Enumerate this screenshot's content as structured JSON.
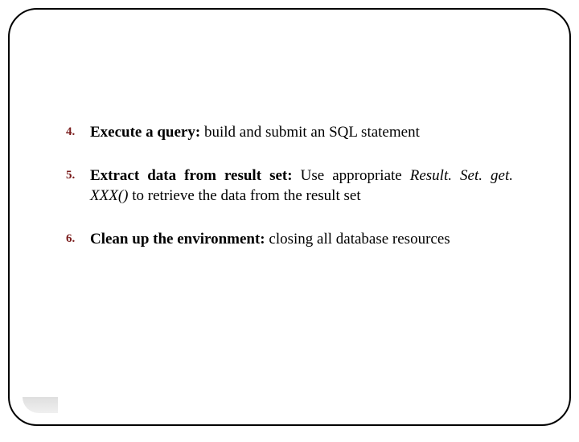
{
  "items": [
    {
      "num": "4.",
      "bold": "Execute a query: ",
      "rest": "build and submit an SQL statement"
    },
    {
      "num": "5.",
      "bold": "Extract data from result set: ",
      "rest_pre": "Use appropriate ",
      "italic": "Result. Set. get. XXX()",
      "rest_post": " to retrieve the data from the result set"
    },
    {
      "num": "6.",
      "bold": "Clean up the environment: ",
      "rest": "closing all database resources"
    }
  ]
}
